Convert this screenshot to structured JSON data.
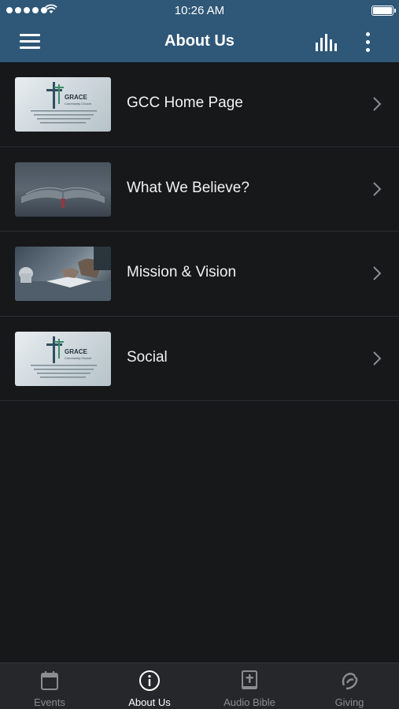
{
  "status_bar": {
    "time": "10:26 AM"
  },
  "header": {
    "title": "About Us"
  },
  "list": [
    {
      "label": "GCC Home Page",
      "thumb": "grace-logo-image",
      "thumb_text": {
        "brand": "GRACE",
        "sub": "Community Church"
      }
    },
    {
      "label": "What We Believe?",
      "thumb": "open-bible-image"
    },
    {
      "label": "Mission & Vision",
      "thumb": "people-at-table-image"
    },
    {
      "label": "Social",
      "thumb": "grace-logo-image",
      "thumb_text": {
        "brand": "GRACE",
        "sub": "Community Church"
      }
    }
  ],
  "tabs": [
    {
      "label": "Events",
      "icon": "calendar-icon",
      "active": false
    },
    {
      "label": "About Us",
      "icon": "info-icon",
      "active": true
    },
    {
      "label": "Audio Bible",
      "icon": "bible-icon",
      "active": false
    },
    {
      "label": "Giving",
      "icon": "giving-icon",
      "active": false
    }
  ],
  "colors": {
    "header": "#2f5777",
    "background": "#17181a",
    "tabbar": "#26272b",
    "tab_inactive": "#8a8d92",
    "tab_active": "#ffffff"
  }
}
